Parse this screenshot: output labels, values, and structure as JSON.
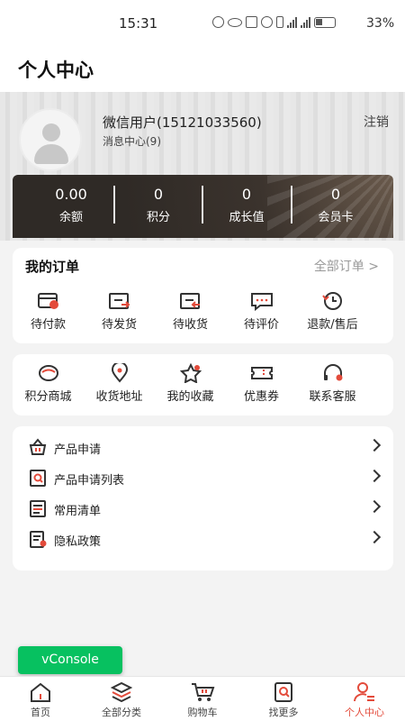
{
  "status_bar": {
    "time": "15:31",
    "battery": "33%"
  },
  "header": {
    "title": "个人中心"
  },
  "profile": {
    "name": "微信用户(15121033560)",
    "message_center": "消息中心(9)",
    "logout": "注销"
  },
  "stats": [
    {
      "value": "0.00",
      "label": "余额"
    },
    {
      "value": "0",
      "label": "积分"
    },
    {
      "value": "0",
      "label": "成长值"
    },
    {
      "value": "0",
      "label": "会员卡"
    }
  ],
  "orders": {
    "title": "我的订单",
    "all_label": "全部订单 >",
    "items": [
      {
        "label": "待付款",
        "icon": "wallet-icon"
      },
      {
        "label": "待发货",
        "icon": "ship-out-icon"
      },
      {
        "label": "待收货",
        "icon": "receive-icon"
      },
      {
        "label": "待评价",
        "icon": "comment-icon"
      },
      {
        "label": "退款/售后",
        "icon": "refund-icon"
      }
    ]
  },
  "services": [
    {
      "label": "积分商城",
      "icon": "points-icon"
    },
    {
      "label": "收货地址",
      "icon": "location-icon"
    },
    {
      "label": "我的收藏",
      "icon": "star-icon"
    },
    {
      "label": "优惠券",
      "icon": "coupon-icon"
    },
    {
      "label": "联系客服",
      "icon": "headset-icon"
    }
  ],
  "menu": [
    {
      "label": "产品申请",
      "icon": "basket-icon"
    },
    {
      "label": "产品申请列表",
      "icon": "list-search-icon"
    },
    {
      "label": "常用清单",
      "icon": "checklist-icon"
    },
    {
      "label": "隐私政策",
      "icon": "policy-icon"
    }
  ],
  "vconsole": "vConsole",
  "tabs": [
    {
      "label": "首页",
      "icon": "home-icon"
    },
    {
      "label": "全部分类",
      "icon": "layers-icon"
    },
    {
      "label": "购物车",
      "icon": "cart-icon"
    },
    {
      "label": "找更多",
      "icon": "find-icon"
    },
    {
      "label": "个人中心",
      "icon": "user-icon",
      "active": true
    }
  ],
  "colors": {
    "accent": "#e34b3b",
    "dark_card": "#3b332d",
    "vconsole": "#07c160"
  }
}
